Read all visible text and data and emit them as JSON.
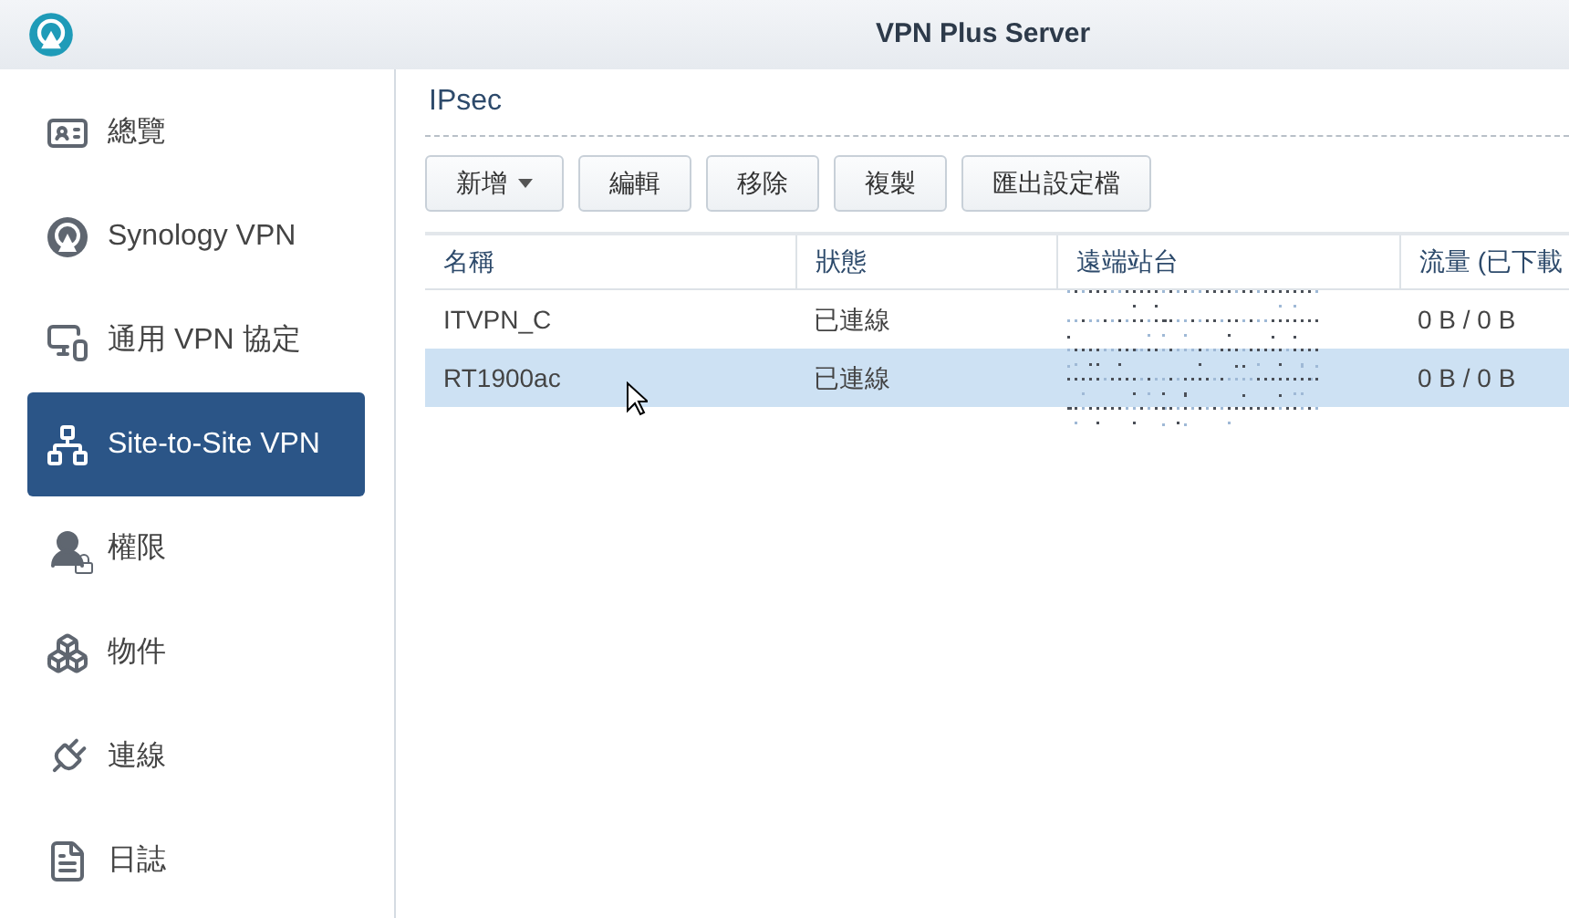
{
  "window": {
    "title": "VPN Plus Server"
  },
  "sidebar": {
    "items": [
      {
        "label": "總覽",
        "selected": false
      },
      {
        "label": "Synology VPN",
        "selected": false
      },
      {
        "label": "通用 VPN 協定",
        "selected": false
      },
      {
        "label": "Site-to-Site VPN",
        "selected": true
      },
      {
        "label": "權限",
        "selected": false
      },
      {
        "label": "物件",
        "selected": false
      },
      {
        "label": "連線",
        "selected": false
      },
      {
        "label": "日誌",
        "selected": false
      }
    ]
  },
  "section": {
    "title": "IPsec"
  },
  "toolbar": [
    {
      "label": "新增",
      "dropdown": true
    },
    {
      "label": "編輯",
      "dropdown": false
    },
    {
      "label": "移除",
      "dropdown": false
    },
    {
      "label": "複製",
      "dropdown": false
    },
    {
      "label": "匯出設定檔",
      "dropdown": false
    }
  ],
  "table": {
    "columns": [
      "名稱",
      "狀態",
      "遠端站台",
      "流量 (已下載"
    ],
    "rows": [
      {
        "name": "ITVPN_C",
        "status": "已連線",
        "traffic": "0 B / 0 B",
        "selected": false
      },
      {
        "name": "RT1900ac",
        "status": "已連線",
        "traffic": "0 B / 0 B",
        "selected": true
      }
    ]
  }
}
